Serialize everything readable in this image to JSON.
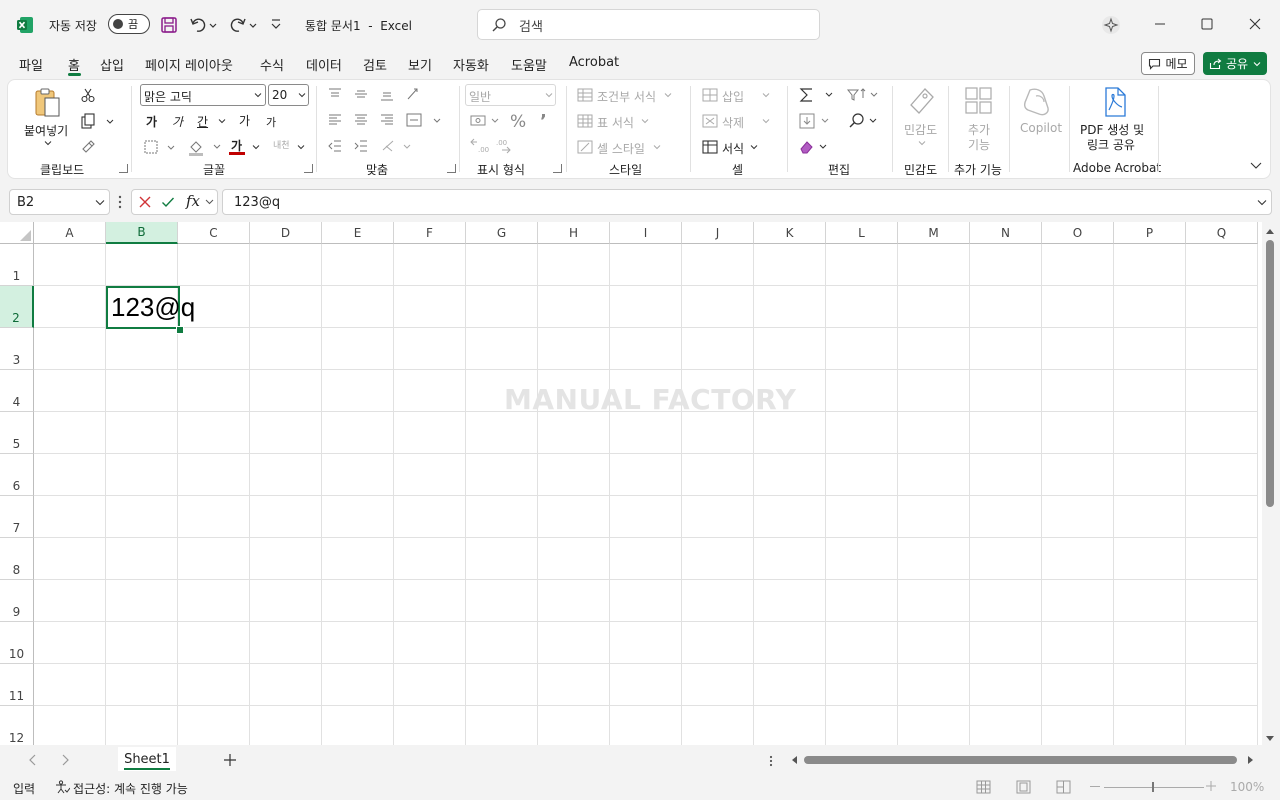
{
  "titlebar": {
    "autosave_label": "자동 저장",
    "autosave_state": "끔",
    "doc_title": "통합 문서1  -  Excel",
    "search_placeholder": "검색"
  },
  "menu": {
    "tabs": [
      "파일",
      "홈",
      "삽입",
      "페이지 레이아웃",
      "수식",
      "데이터",
      "검토",
      "보기",
      "자동화",
      "도움말",
      "Acrobat"
    ],
    "active": "홈",
    "memo": "메모",
    "share": "공유"
  },
  "ribbon": {
    "clipboard": {
      "paste": "붙여넣기",
      "label": "클립보드"
    },
    "font": {
      "name": "맑은 고딕",
      "size": "20",
      "bold": "가",
      "italic": "가",
      "underline": "간",
      "grow": "가",
      "shrink": "가",
      "color_letter": "가",
      "phonetic": "내천",
      "label": "글꼴"
    },
    "alignment": {
      "label": "맞춤"
    },
    "number": {
      "format": "일반",
      "label": "표시 형식"
    },
    "styles": {
      "conditional": "조건부 서식",
      "table": "표 서식",
      "cell": "셀 스타일",
      "label": "스타일"
    },
    "cells": {
      "insert": "삽입",
      "delete": "삭제",
      "format": "서식",
      "label": "셀"
    },
    "editing": {
      "label": "편집"
    },
    "sensitivity": {
      "button": "민감도",
      "label": "민감도"
    },
    "addins": {
      "button_line1": "추가",
      "button_line2": "기능",
      "label": "추가 기능"
    },
    "copilot": {
      "button": "Copilot"
    },
    "acrobat": {
      "button_line1": "PDF 생성 및",
      "button_line2": "링크 공유",
      "label": "Adobe Acrobat"
    }
  },
  "formula_bar": {
    "name_box": "B2",
    "fx": "fx",
    "content": "123@q"
  },
  "sheet": {
    "columns": [
      "A",
      "B",
      "C",
      "D",
      "E",
      "F",
      "G",
      "H",
      "I",
      "J",
      "K",
      "L",
      "M",
      "N",
      "O",
      "P",
      "Q"
    ],
    "rows": [
      "1",
      "2",
      "3",
      "4",
      "5",
      "6",
      "7",
      "8",
      "9",
      "10",
      "11",
      "12"
    ],
    "active_cell": "B2",
    "cell_b2": "123@q",
    "watermark": "MANUAL FACTORY"
  },
  "sheet_tabs": {
    "active": "Sheet1"
  },
  "status": {
    "mode": "입력",
    "accessibility": "접근성: 계속 진행 가능",
    "zoom": "100%"
  },
  "colors": {
    "accent": "#107c41",
    "font_color_bar": "#c00000"
  }
}
